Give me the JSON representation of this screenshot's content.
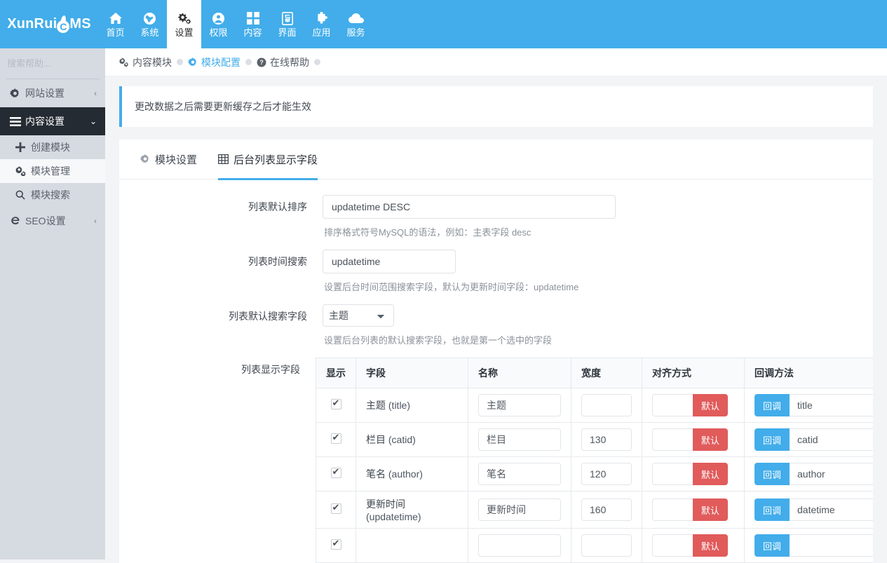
{
  "brand": {
    "name_prefix": "XunRui",
    "name_mid": "C",
    "name_suffix": "MS"
  },
  "topnav": {
    "items": [
      {
        "label": "首页",
        "icon": "home-icon"
      },
      {
        "label": "系统",
        "icon": "globe-icon"
      },
      {
        "label": "设置",
        "icon": "gears-icon",
        "active": true
      },
      {
        "label": "权限",
        "icon": "user-circle-icon"
      },
      {
        "label": "内容",
        "icon": "grid-icon"
      },
      {
        "label": "界面",
        "icon": "html5-icon"
      },
      {
        "label": "应用",
        "icon": "plugin-icon"
      },
      {
        "label": "服务",
        "icon": "cloud-icon"
      }
    ]
  },
  "sidebar": {
    "search_placeholder": "搜索帮助...",
    "search_value": "",
    "search_icon": "search-icon",
    "items": [
      {
        "label": "网站设置",
        "icon": "gear-icon",
        "chevron": "‹",
        "state": "normal"
      },
      {
        "label": "内容设置",
        "icon": "bars-icon",
        "chevron": "⌄",
        "state": "active"
      }
    ],
    "subitems": [
      {
        "label": "创建模块",
        "icon": "plus-icon",
        "selected": false
      },
      {
        "label": "模块管理",
        "icon": "gears-icon",
        "selected": true
      },
      {
        "label": "模块搜索",
        "icon": "search-icon",
        "selected": false
      }
    ],
    "trailing": [
      {
        "label": "SEO设置",
        "icon": "ie-icon",
        "chevron": "‹"
      }
    ]
  },
  "breadcrumb": [
    {
      "label": "内容模块",
      "icon": "gears-icon",
      "active": false
    },
    {
      "label": "模块配置",
      "icon": "gear-icon",
      "active": true
    },
    {
      "label": "在线帮助",
      "icon": "question-icon",
      "active": false
    }
  ],
  "alert": {
    "text": "更改数据之后需要更新缓存之后才能生效",
    "accent": "#42adea"
  },
  "tabs": [
    {
      "label": "模块设置",
      "icon": "gear-icon",
      "active": false
    },
    {
      "label": "后台列表显示字段",
      "icon": "table-icon",
      "active": true
    }
  ],
  "form": {
    "sort": {
      "label": "列表默认排序",
      "value": "updatetime DESC",
      "placeholder": "",
      "hint": "排序格式符号MySQL的语法，例如：主表字段 desc"
    },
    "timesearch": {
      "label": "列表时间搜索",
      "value": "updatetime",
      "placeholder": "",
      "hint": "设置后台时间范围搜索字段，默认为更新时间字段：updatetime"
    },
    "defaultsearch": {
      "label": "列表默认搜索字段",
      "value": "主题",
      "options": [
        "主题"
      ],
      "hint": "设置后台列表的默认搜索字段，也就是第一个选中的字段"
    },
    "displayfields": {
      "label": "列表显示字段"
    }
  },
  "table": {
    "headers": [
      "显示",
      "字段",
      "名称",
      "宽度",
      "对齐方式",
      "回调方法"
    ],
    "default_btn_label": "默认",
    "callback_btn_label": "回调",
    "rows": [
      {
        "checked": true,
        "field_cn": "主题",
        "field_en": "(title)",
        "name": "主题",
        "width": "",
        "align": "",
        "callback": "title"
      },
      {
        "checked": true,
        "field_cn": "栏目",
        "field_en": "(catid)",
        "name": "栏目",
        "width": "130",
        "align": "",
        "callback": "catid"
      },
      {
        "checked": true,
        "field_cn": "笔名",
        "field_en": "(author)",
        "name": "笔名",
        "width": "120",
        "align": "",
        "callback": "author"
      },
      {
        "checked": true,
        "field_cn": "更新时间",
        "field_en": "(updatetime)",
        "name": "更新时间",
        "width": "160",
        "align": "",
        "callback": "datetime"
      },
      {
        "checked": true,
        "field_cn": "",
        "field_en": "",
        "name": "",
        "width": "",
        "align": "",
        "callback": ""
      }
    ]
  },
  "colors": {
    "brand_blue": "#42adea",
    "sidebar_bg": "#d6dae1",
    "sidebar_active": "#252b33",
    "danger_red": "#e15b5b"
  }
}
